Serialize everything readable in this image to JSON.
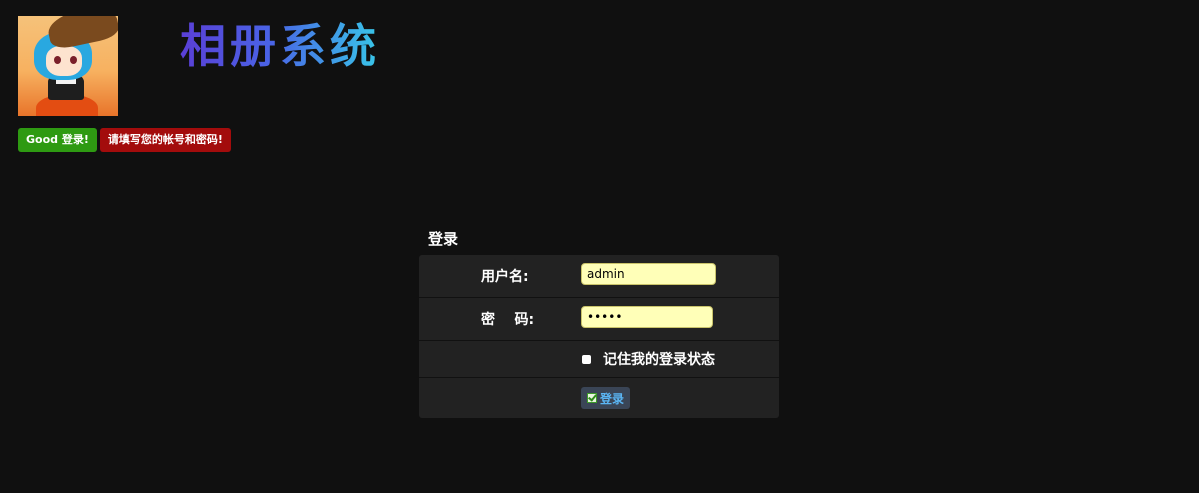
{
  "header": {
    "site_title": "相册系统"
  },
  "badges": {
    "success": "Good 登录!",
    "error": "请填写您的帐号和密码!"
  },
  "login": {
    "title": "登录",
    "username_label": "用户名:",
    "username_value": "admin",
    "password_label": "密    码:",
    "password_value": "•••••",
    "remember_label": "记住我的登录状态",
    "submit_label": "登录"
  },
  "colors": {
    "background": "#101010",
    "panel": "#222222",
    "input_bg": "#ffffb8",
    "success": "#2e9a12",
    "error": "#a30c0c",
    "submit_text": "#5bb6f5"
  },
  "icons": {
    "submit": "check-icon"
  }
}
